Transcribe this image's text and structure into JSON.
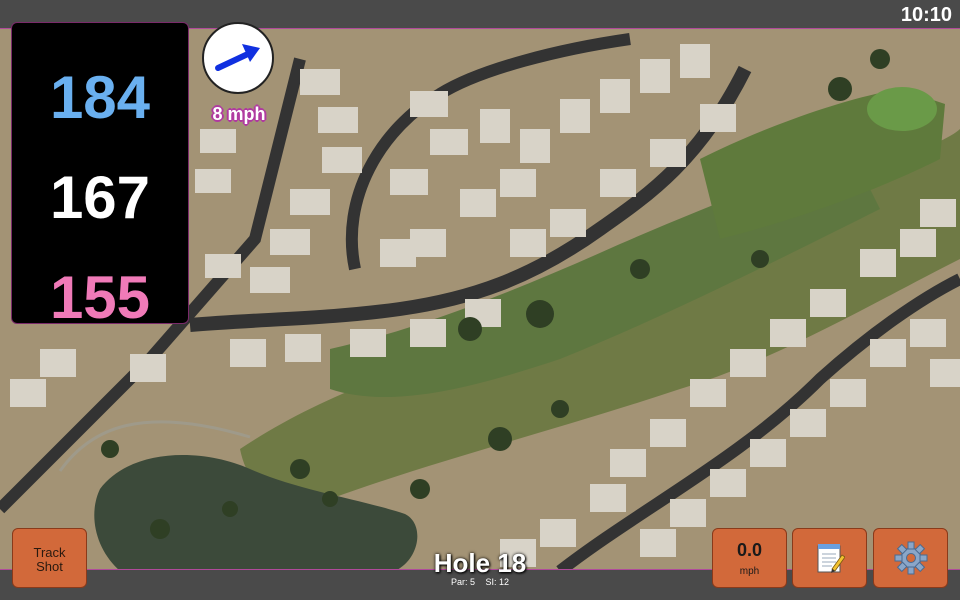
{
  "status": {
    "clock": "10:10"
  },
  "distances": {
    "back": "184",
    "middle": "167",
    "front": "155",
    "colors": {
      "back": "#6ab0f0",
      "middle": "#ffffff",
      "front": "#f07ab8"
    }
  },
  "wind": {
    "label": "8 mph",
    "arrow_icon": "arrow-right-icon"
  },
  "buttons": {
    "track_shot_line1": "Track",
    "track_shot_line2": "Shot",
    "speed_value": "0.0",
    "speed_unit": "mph",
    "notes_icon": "notepad-icon",
    "settings_icon": "gear-icon"
  },
  "hole": {
    "title": "Hole 18",
    "par": "Par: 5",
    "si": "SI: 12"
  },
  "colors": {
    "button": "#d2693a",
    "accent": "#b04a9a"
  }
}
